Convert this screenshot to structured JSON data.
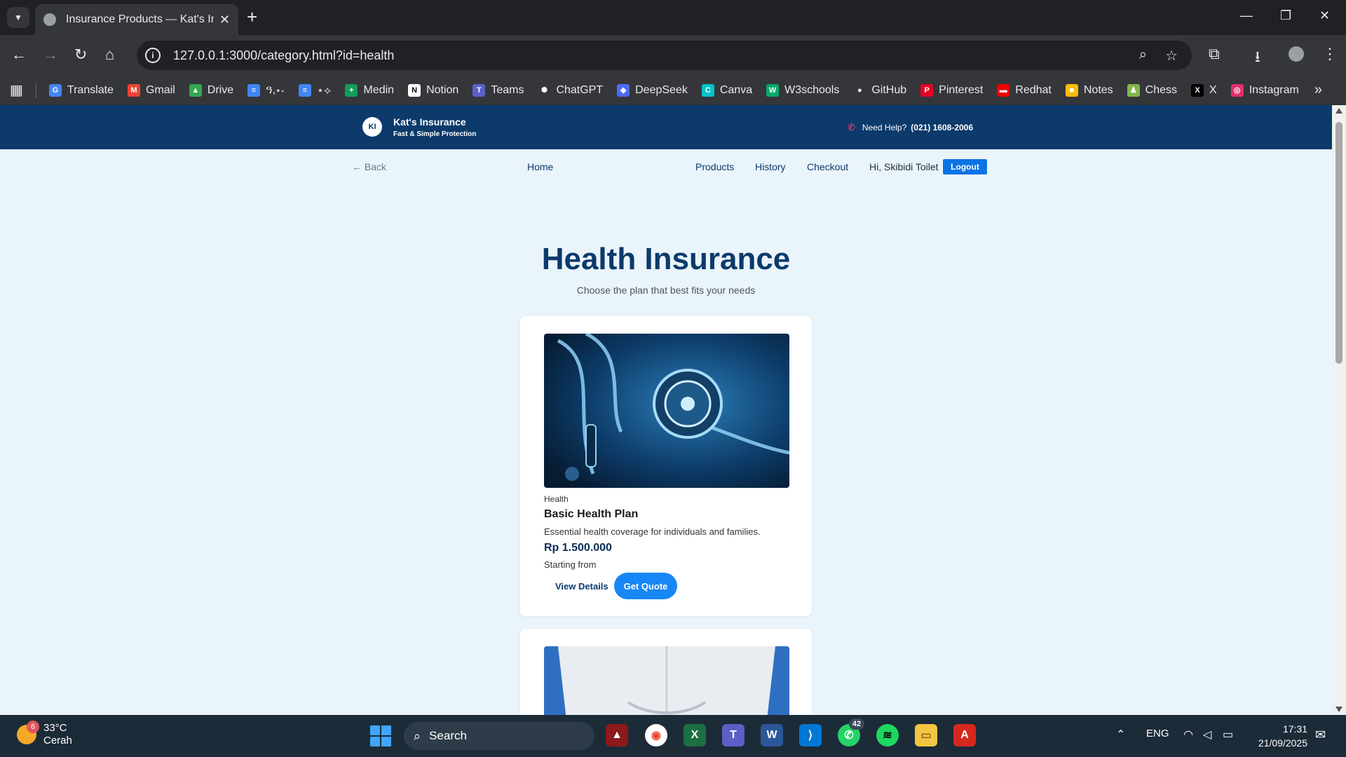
{
  "browser": {
    "tab_title": "Insurance Products — Kat's Insu",
    "url": "127.0.0.1:3000/category.html?id=health",
    "bookmarks": [
      {
        "label": "Translate",
        "icon": "google-translate-icon",
        "color": "#4285f4",
        "glyph": "G"
      },
      {
        "label": "Gmail",
        "icon": "gmail-icon",
        "color": "#ea4335",
        "glyph": "M"
      },
      {
        "label": "Drive",
        "icon": "google-drive-icon",
        "color": "#34a853",
        "glyph": "▲"
      },
      {
        "label": "ዓ,⋆˖",
        "icon": "google-docs-icon",
        "color": "#4285f4",
        "glyph": "≡"
      },
      {
        "label": "⋆⟡",
        "icon": "google-docs-icon",
        "color": "#4285f4",
        "glyph": "≡"
      },
      {
        "label": "Medin",
        "icon": "google-sheets-icon",
        "color": "#0f9d58",
        "glyph": "+"
      },
      {
        "label": "Notion",
        "icon": "notion-icon",
        "color": "#ffffff",
        "glyph": "N"
      },
      {
        "label": "Teams",
        "icon": "teams-icon",
        "color": "#5b5fc7",
        "glyph": "T"
      },
      {
        "label": "ChatGPT",
        "icon": "chatgpt-icon",
        "color": "#35363a",
        "glyph": "✺"
      },
      {
        "label": "DeepSeek",
        "icon": "deepseek-icon",
        "color": "#4d6bfe",
        "glyph": "◆"
      },
      {
        "label": "Canva",
        "icon": "canva-icon",
        "color": "#00c4cc",
        "glyph": "C"
      },
      {
        "label": "W3schools",
        "icon": "w3schools-icon",
        "color": "#04aa6d",
        "glyph": "W"
      },
      {
        "label": "GitHub",
        "icon": "github-icon",
        "color": "#35363a",
        "glyph": "●"
      },
      {
        "label": "Pinterest",
        "icon": "pinterest-icon",
        "color": "#e60023",
        "glyph": "P"
      },
      {
        "label": "Redhat",
        "icon": "redhat-icon",
        "color": "#ee0000",
        "glyph": "▬"
      },
      {
        "label": "Notes",
        "icon": "notes-icon",
        "color": "#fbbc04",
        "glyph": "■"
      },
      {
        "label": "Chess",
        "icon": "chess-icon",
        "color": "#81b64c",
        "glyph": "♟"
      },
      {
        "label": "X",
        "icon": "x-icon",
        "color": "#000000",
        "glyph": "X"
      },
      {
        "label": "Instagram",
        "icon": "instagram-icon",
        "color": "#e1306c",
        "glyph": "◎"
      }
    ]
  },
  "site": {
    "logo_initials": "KI",
    "brand_name": "Kat's Insurance",
    "brand_tagline": "Fast & Simple Protection",
    "help_label": "Need Help?",
    "help_phone": "(021) 1608-2006",
    "back_label": "← Back",
    "nav": {
      "home": "Home",
      "products": "Products",
      "history": "History",
      "checkout": "Checkout"
    },
    "greeting": "Hi, Skibidi Toilet",
    "logout_label": "Logout",
    "page_title": "Health Insurance",
    "page_subtitle": "Choose the plan that best fits your needs",
    "products": [
      {
        "category": "Health",
        "name": "Basic Health Plan",
        "description": "Essential health coverage for individuals and families.",
        "price": "Rp 1.500.000",
        "price_note": "Starting from",
        "view_label": "View Details",
        "quote_label": "Get Quote"
      }
    ]
  },
  "taskbar": {
    "weather_badge": "6",
    "temperature": "33°C",
    "condition": "Cerah",
    "search_label": "Search",
    "whatsapp_badge": "42",
    "language": "ENG",
    "time": "17:31",
    "date": "21/09/2025"
  }
}
